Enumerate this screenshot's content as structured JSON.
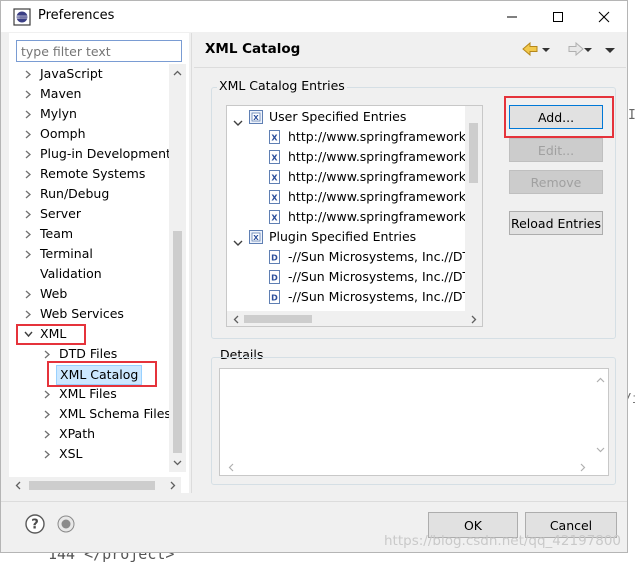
{
  "window": {
    "title": "Preferences"
  },
  "filter": {
    "placeholder": "type filter text"
  },
  "tree": {
    "items": [
      {
        "label": "JavaScript",
        "arrow": "right"
      },
      {
        "label": "Maven",
        "arrow": "right"
      },
      {
        "label": "Mylyn",
        "arrow": "right"
      },
      {
        "label": "Oomph",
        "arrow": "right"
      },
      {
        "label": "Plug-in Development",
        "arrow": "right"
      },
      {
        "label": "Remote Systems",
        "arrow": "right"
      },
      {
        "label": "Run/Debug",
        "arrow": "right"
      },
      {
        "label": "Server",
        "arrow": "right"
      },
      {
        "label": "Team",
        "arrow": "right"
      },
      {
        "label": "Terminal",
        "arrow": "right"
      },
      {
        "label": "Validation",
        "arrow": "none"
      },
      {
        "label": "Web",
        "arrow": "right"
      },
      {
        "label": "Web Services",
        "arrow": "right"
      },
      {
        "label": "XML",
        "arrow": "down"
      }
    ],
    "xml_children": [
      {
        "label": "DTD Files",
        "arrow": "right"
      },
      {
        "label": "XML Catalog",
        "arrow": "none",
        "selected": true
      },
      {
        "label": "XML Files",
        "arrow": "right"
      },
      {
        "label": "XML Schema Files",
        "arrow": "right"
      },
      {
        "label": "XPath",
        "arrow": "right"
      },
      {
        "label": "XSL",
        "arrow": "right"
      }
    ]
  },
  "page": {
    "title": "XML Catalog"
  },
  "catalog": {
    "group_label": "XML Catalog Entries",
    "user_node": "User Specified Entries",
    "user_entries": [
      "http://www.springframework.org/",
      "http://www.springframework.org/",
      "http://www.springframework.org/",
      "http://www.springframework.org/",
      "http://www.springframework.org/"
    ],
    "plugin_node": "Plugin Specified Entries",
    "plugin_entries": [
      "-//Sun Microsystems, Inc.//DTD C",
      "-//Sun Microsystems, Inc.//DTD E",
      "-//Sun Microsystems, Inc.//DTD E"
    ],
    "buttons": {
      "add": "Add...",
      "edit": "Edit...",
      "remove": "Remove",
      "reload": "Reload Entries"
    }
  },
  "details": {
    "label": "Details"
  },
  "footer": {
    "ok": "OK",
    "cancel": "Cancel"
  },
  "background": {
    "code_line": "144 </project>",
    "edge_right_1": "I",
    "edge_right_2": "/i",
    "watermark": "https://blog.csdn.net/qq_42197800"
  },
  "colors": {
    "highlight_border": "#e5333b",
    "selection": "#cce8ff",
    "window_bg": "#f0f0f0"
  }
}
